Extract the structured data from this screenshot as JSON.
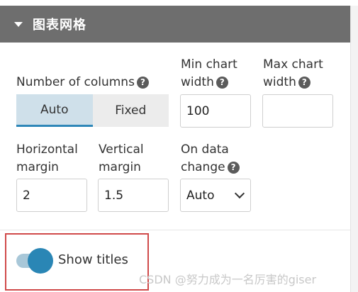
{
  "header": {
    "title": "图表网格"
  },
  "fields": {
    "columns": {
      "label": "Number of columns",
      "options": [
        {
          "label": "Auto",
          "active": true
        },
        {
          "label": "Fixed",
          "active": false
        }
      ]
    },
    "min_width": {
      "label_line1": "Min chart",
      "label_line2": "width",
      "value": "100"
    },
    "max_width": {
      "label_line1": "Max chart",
      "label_line2": "width",
      "value": ""
    },
    "h_margin": {
      "label_line1": "Horizontal",
      "label_line2": "margin",
      "value": "2"
    },
    "v_margin": {
      "label_line1": "Vertical",
      "label_line2": "margin",
      "value": "1.5"
    },
    "on_change": {
      "label_line1": "On data",
      "label_line2": "change",
      "value": "Auto"
    }
  },
  "toggle": {
    "label": "Show titles",
    "on": true
  },
  "help_glyph": "?",
  "watermark": "CSDN @努力成为一名厉害的giser",
  "colors": {
    "header_bg": "#6e6e6e",
    "accent": "#2a86b5",
    "highlight": "#d04a4a"
  }
}
